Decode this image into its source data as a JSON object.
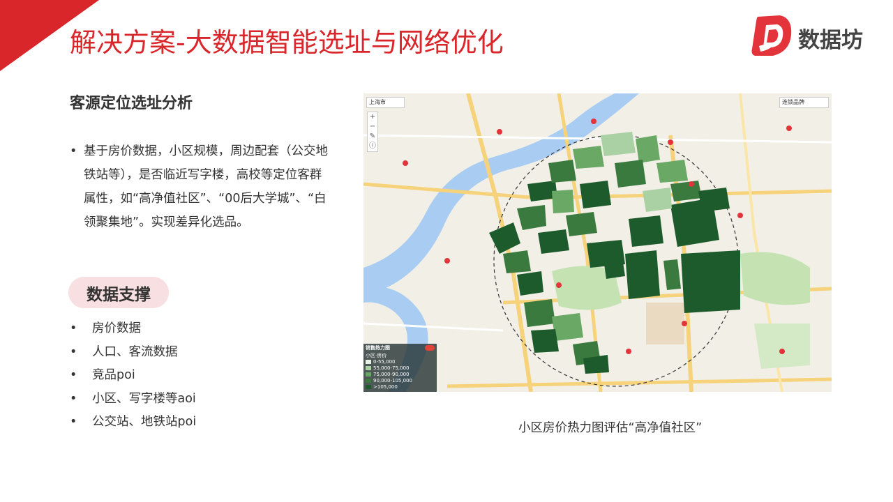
{
  "header": {
    "title": "解决方案-大数据智能选址与网络优化",
    "logo_text": "数据坊",
    "accent_color": "#d9262b"
  },
  "section": {
    "title": "客源定位选址分析",
    "description": "基于房价数据，小区规模，周边配套（公交地铁站等），是否临近写字楼，高校等定位客群属性，如“高净值社区”、“00后大学城”、“白领聚集地”。实现差异化选品。"
  },
  "support": {
    "label": "数据支撑",
    "items": [
      "房价数据",
      "人口、客流数据",
      "竞品poi",
      "小区、写字楼等aoi",
      "公交站、地铁站poi"
    ]
  },
  "map": {
    "caption": "小区房价热力图评估“高净值社区”",
    "city_select": "上海市",
    "layer_select": "连锁品牌",
    "legend_title": "销售热力图",
    "legend_sub": "小区·房价",
    "legend_items": [
      {
        "label": "0-55,000",
        "color": "#e8f2e6"
      },
      {
        "label": "55,000-75,000",
        "color": "#a9d1a4"
      },
      {
        "label": "75,000-90,000",
        "color": "#6aa866"
      },
      {
        "label": "90,000-105,000",
        "color": "#3b7a3f"
      },
      {
        "label": ">105,000",
        "color": "#1e5b2c"
      }
    ]
  }
}
